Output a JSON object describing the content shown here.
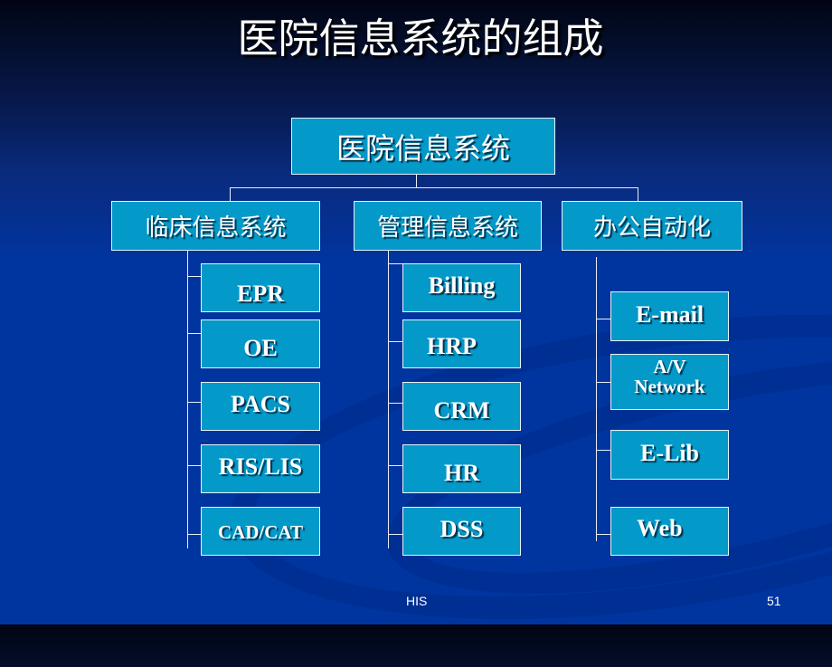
{
  "slide": {
    "title": "医院信息系统的组成",
    "footer_left": "HIS",
    "page_number": "51"
  },
  "colors": {
    "box_fill": "#0399c9",
    "box_border": "#e8f2f8",
    "background_bottom": "#0035a0",
    "background_top": "#020414",
    "text": "#ffffff"
  },
  "diagram": {
    "root": "医院信息系统",
    "branches": [
      {
        "label": "临床信息系统",
        "children": [
          "EPR",
          "OE",
          "PACS",
          "RIS/LIS",
          "CAD/CAT"
        ]
      },
      {
        "label": "管理信息系统",
        "children": [
          "Billing",
          "HRP",
          "CRM",
          "HR",
          "DSS"
        ]
      },
      {
        "label": "办公自动化",
        "children": [
          "E-mail",
          "A/V Network",
          "E-Lib",
          "Web"
        ]
      }
    ]
  }
}
